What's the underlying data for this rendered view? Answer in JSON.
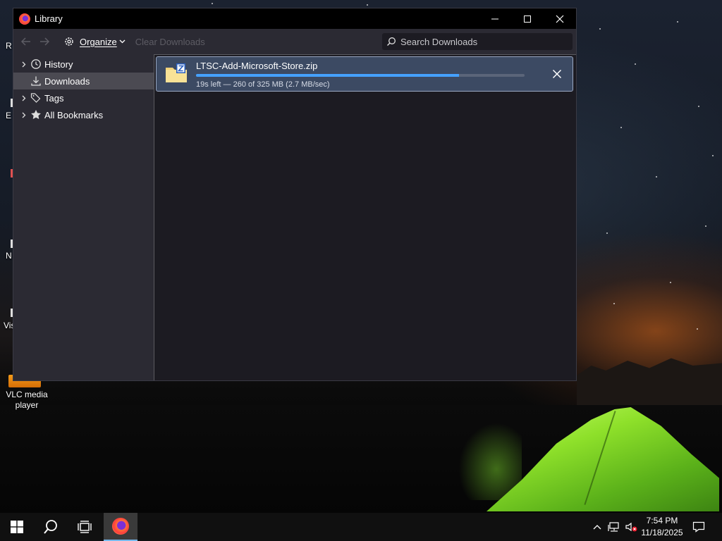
{
  "window": {
    "title": "Library",
    "controls": {
      "minimize": "—",
      "maximize": "☐",
      "close": "✕"
    }
  },
  "toolbar": {
    "organize_label": "Organize",
    "clear_label": "Clear Downloads",
    "search_placeholder": "Search Downloads"
  },
  "sidebar": {
    "items": [
      {
        "label": "History",
        "icon": "clock-icon",
        "expandable": true,
        "selected": false
      },
      {
        "label": "Downloads",
        "icon": "download-icon",
        "expandable": false,
        "selected": true
      },
      {
        "label": "Tags",
        "icon": "tag-icon",
        "expandable": true,
        "selected": false
      },
      {
        "label": "All Bookmarks",
        "icon": "star-icon",
        "expandable": true,
        "selected": false
      }
    ]
  },
  "downloads": [
    {
      "filename": "LTSC-Add-Microsoft-Store.zip",
      "status": "19s left — 260 of 325 MB (2.7 MB/sec)",
      "progress_fraction": 0.8
    }
  ],
  "desktop": {
    "vlc_label": "VLC media player",
    "fragments": [
      "R",
      "E",
      "N",
      "Vis"
    ]
  },
  "taskbar": {
    "time": "7:54 PM",
    "date": "11/18/2025"
  },
  "colors": {
    "accent": "#45a1ff",
    "selection": "#3c4a63",
    "sidebar_bg": "#2b2a33",
    "content_bg": "#1c1b22",
    "titlebar_bg": "#000000"
  }
}
